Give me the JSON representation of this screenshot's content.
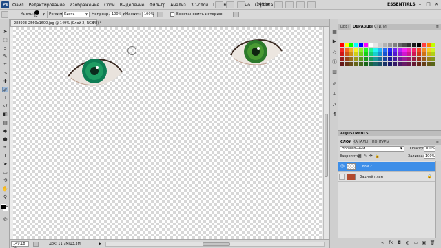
{
  "menubar": {
    "app_badge": "Ps",
    "menus": [
      "Файл",
      "Редактирование",
      "Изображение",
      "Слой",
      "Выделение",
      "Фильтр",
      "Анализ",
      "3D-слои",
      "Просмотр",
      "Окно",
      "Справка"
    ],
    "zoom": "149%",
    "workspace": "ESSENTIALS"
  },
  "options": {
    "brush_label": "Кисть:",
    "brush_size": "42",
    "mode_label": "Режим:",
    "mode_value": "Кисть",
    "opacity_label": "Непрозр.:",
    "opacity_value": "100%",
    "flow_label": "Нажим:",
    "flow_value": "100%",
    "history_label": "Восстановить историю"
  },
  "document": {
    "tab_title": "288923-2560x1600.jpg @ 149% (Слой 2, RGB/8) *",
    "status_zoom": "149,18 %",
    "doc_info": "Док: 11,7M/13,3M"
  },
  "panels": {
    "top_tabs": [
      "ЦВЕТ",
      "ОБРАЗЦЫ",
      "СТИЛИ"
    ],
    "adjustments": "ADJUSTMENTS",
    "layer_tabs": [
      "СЛОИ",
      "КАНАЛЫ",
      "КОНТУРЫ"
    ],
    "blend_mode": "Нормальный",
    "opacity_label": "Opacity:",
    "opacity_value": "100%",
    "lock_label": "Закрепить:",
    "fill_label": "Заливка:",
    "fill_value": "100%",
    "layers": [
      {
        "name": "Слой 2",
        "selected": true
      },
      {
        "name": "Задний план",
        "selected": false
      }
    ]
  },
  "colors": {
    "accent": "#3d8ee8",
    "foreground": "#000000",
    "background": "#ffffff"
  }
}
